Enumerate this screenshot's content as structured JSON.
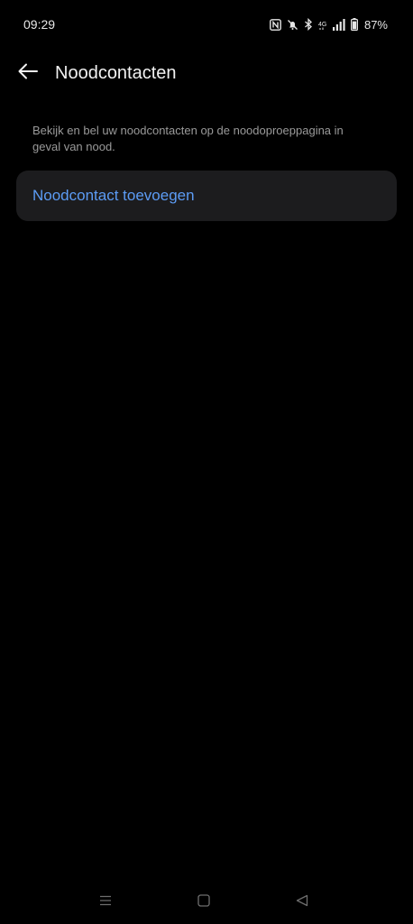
{
  "status_bar": {
    "time": "09:29",
    "battery": "87%",
    "icons": [
      "nfc-icon",
      "mute-icon",
      "bluetooth-icon",
      "4g-icon",
      "signal-icon",
      "battery-icon"
    ]
  },
  "header": {
    "back_icon": "arrow-left-icon",
    "title": "Noodcontacten"
  },
  "main": {
    "description": "Bekijk en bel uw noodcontacten op de noodoproeppagina in geval van nood.",
    "add_contact_label": "Noodcontact toevoegen"
  },
  "nav_bar": {
    "icons": [
      "menu-icon",
      "home-icon",
      "back-icon"
    ]
  },
  "colors": {
    "background": "#000000",
    "card": "#1c1c1e",
    "accent": "#5c9cf5",
    "secondary_text": "#9a9a9a"
  }
}
